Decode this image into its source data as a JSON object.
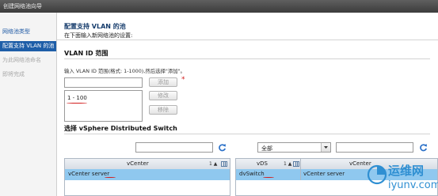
{
  "window": {
    "title": "创建网络池向导"
  },
  "sidebar": {
    "items": [
      {
        "label": "网络池类型",
        "state": "link"
      },
      {
        "label": "配置支持 VLAN 的池",
        "state": "active"
      },
      {
        "label": "为此网络池命名",
        "state": "disabled"
      },
      {
        "label": "即将完成",
        "state": "disabled"
      }
    ]
  },
  "page": {
    "title": "配置支持 VLAN 的池",
    "subtitle": "在下面输入新网络池的设置:"
  },
  "vlan": {
    "heading": "VLAN ID 范围",
    "instruction": "输入 VLAN ID 范围(格式: 1-1000),然后选择\"添加\"。",
    "input_value": "",
    "required_mark": "*",
    "add_label": "添加",
    "modify_label": "修改",
    "remove_label": "移除",
    "ranges": [
      "1 - 100"
    ]
  },
  "dvs": {
    "heading": "选择 vSphere Distributed Switch",
    "left_filter": "",
    "right_dropdown": "全部",
    "right_filter": "",
    "left_table": {
      "header": "vCenter",
      "sort_label": "1 ▲",
      "rows": [
        "vCenter server"
      ]
    },
    "right_table": {
      "headers": [
        "vDS",
        "vCenter"
      ],
      "sort_label": "1 ▲",
      "rows": [
        [
          "dvSwitch",
          "vCenter server"
        ]
      ]
    }
  },
  "watermark": {
    "text": "运维网",
    "url": "iyunv.com"
  },
  "colors": {
    "accent": "#1e5ea8",
    "selected_row": "#8fc8ef",
    "annotation": "#d21c1c"
  }
}
